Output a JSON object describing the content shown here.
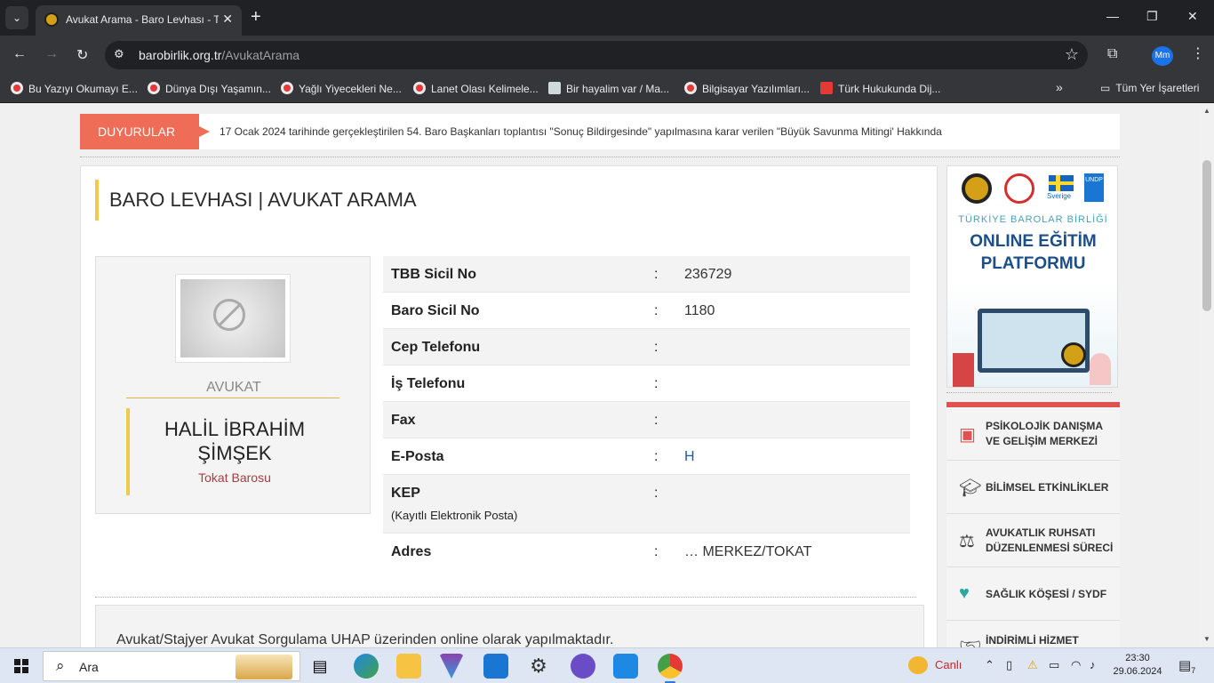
{
  "browser": {
    "tab_title": "Avukat Arama - Baro Levhası - T",
    "url_domain": "barobirlik.org.tr",
    "url_path": "/AvukatArama",
    "profile_initials": "Mm",
    "bookmarks": [
      "Bu Yazıyı Okumayı E...",
      "Dünya Dışı Yaşamın...",
      "Yağlı Yiyecekleri Ne...",
      "Lanet Olası Kelimele...",
      "Bir hayalim var / Ma...",
      "Bilgisayar Yazılımları...",
      "Türk Hukukunda Dij..."
    ],
    "all_bookmarks": "Tüm Yer İşaretleri"
  },
  "announcement": {
    "label": "DUYURULAR",
    "text": "17 Ocak 2024 tarihinde gerçekleştirilen 54. Baro Başkanları toplantısı \"Sonuç Bildirgesinde\" yapılmasına karar verilen \"Büyük Savunma Mitingi' Hakkında"
  },
  "page": {
    "heading": "BARO LEVHASI | AVUKAT ARAMA"
  },
  "profile": {
    "role": "AVUKAT",
    "name": "HALİL İBRAHİM ŞİMŞEK",
    "bar": "Tokat Barosu"
  },
  "info_rows": [
    {
      "label": "TBB Sicil No",
      "value": "236729"
    },
    {
      "label": "Baro Sicil No",
      "value": "1180"
    },
    {
      "label": "Cep Telefonu",
      "value": ""
    },
    {
      "label": "İş Telefonu",
      "value": ""
    },
    {
      "label": "Fax",
      "value": ""
    },
    {
      "label": "E-Posta",
      "value": "H"
    },
    {
      "label": "KEP",
      "sublabel": "(Kayıtlı Elektronik Posta)",
      "value": ""
    },
    {
      "label": "Adres",
      "value": "… MERKEZ/TOKAT"
    }
  ],
  "notice": "Avukat/Stajyer Avukat Sorgulama UHAP üzerinden online olarak yapılmaktadır.",
  "ad": {
    "small": "TÜRKİYE BAROLAR BİRLİĞİ",
    "big_line1": "ONLINE EĞİTİM",
    "big_line2": "PLATFORMU",
    "sweden": "Sverige",
    "undp": "UNDP"
  },
  "side_menu": [
    {
      "label": "PSİKOLOJİK DANIŞMA VE GELİŞİM MERKEZİ",
      "icon": "calendar-plus-icon"
    },
    {
      "label": "BİLİMSEL ETKİNLİKLER",
      "icon": "graduation-cap-icon"
    },
    {
      "label": "AVUKATLIK RUHSATI DÜZENLENMESİ SÜRECİ",
      "icon": "scales-icon"
    },
    {
      "label": "SAĞLIK KÖŞESİ / SYDF",
      "icon": "heart-pulse-icon"
    },
    {
      "label": "İNDİRİMLİ HİZMET",
      "icon": "handshake-icon"
    }
  ],
  "taskbar": {
    "search_placeholder": "Ara",
    "weather": "Canlı",
    "time": "23:30",
    "date": "29.06.2024",
    "notif_count": "7"
  },
  "colors": {
    "accent_yellow": "#f2c94c",
    "announce_red": "#ef6c57",
    "link_blue": "#1f5aa6",
    "menu_red": "#e05252"
  }
}
